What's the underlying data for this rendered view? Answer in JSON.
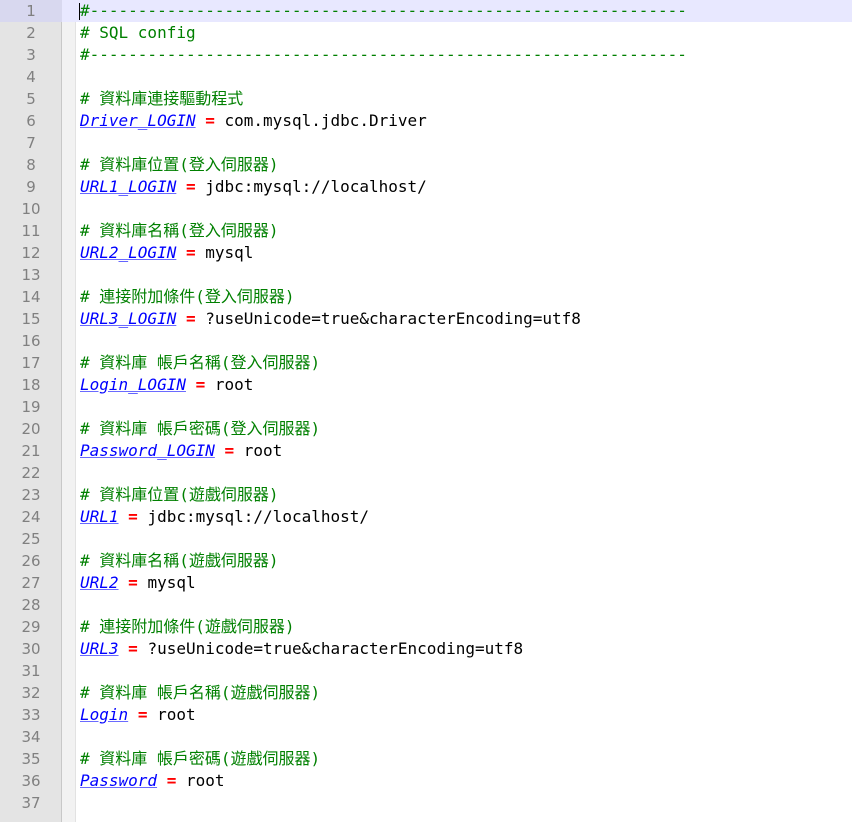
{
  "editor": {
    "colors": {
      "comment": "#008000",
      "key": "#0000ff",
      "operator": "#ff0000",
      "value": "#000000",
      "gutter_bg": "#e4e4e4",
      "line_number": "#808080",
      "current_line": "#e8e8ff"
    },
    "current_line": 1,
    "lines": [
      {
        "num": "1",
        "type": "comment",
        "text": "#--------------------------------------------------------------"
      },
      {
        "num": "2",
        "type": "comment",
        "text": "# SQL config"
      },
      {
        "num": "3",
        "type": "comment",
        "text": "#--------------------------------------------------------------"
      },
      {
        "num": "4",
        "type": "empty"
      },
      {
        "num": "5",
        "type": "comment",
        "text": "# 資料庫連接驅動程式"
      },
      {
        "num": "6",
        "type": "prop",
        "key": "Driver_LOGIN",
        "op": "=",
        "value": "com.mysql.jdbc.Driver"
      },
      {
        "num": "7",
        "type": "empty"
      },
      {
        "num": "8",
        "type": "comment",
        "text": "# 資料庫位置(登入伺服器)"
      },
      {
        "num": "9",
        "type": "prop",
        "key": "URL1_LOGIN",
        "op": "=",
        "value": "jdbc:mysql://localhost/"
      },
      {
        "num": "10",
        "type": "empty"
      },
      {
        "num": "11",
        "type": "comment",
        "text": "# 資料庫名稱(登入伺服器)"
      },
      {
        "num": "12",
        "type": "prop",
        "key": "URL2_LOGIN",
        "op": "=",
        "value": "mysql"
      },
      {
        "num": "13",
        "type": "empty"
      },
      {
        "num": "14",
        "type": "comment",
        "text": "# 連接附加條件(登入伺服器)"
      },
      {
        "num": "15",
        "type": "prop",
        "key": "URL3_LOGIN",
        "op": "=",
        "value": "?useUnicode=true&characterEncoding=utf8"
      },
      {
        "num": "16",
        "type": "empty"
      },
      {
        "num": "17",
        "type": "comment",
        "text": "# 資料庫 帳戶名稱(登入伺服器)"
      },
      {
        "num": "18",
        "type": "prop",
        "key": "Login_LOGIN",
        "op": "=",
        "value": "root"
      },
      {
        "num": "19",
        "type": "empty"
      },
      {
        "num": "20",
        "type": "comment",
        "text": "# 資料庫 帳戶密碼(登入伺服器)"
      },
      {
        "num": "21",
        "type": "prop",
        "key": "Password_LOGIN",
        "op": "=",
        "value": "root"
      },
      {
        "num": "22",
        "type": "empty"
      },
      {
        "num": "23",
        "type": "comment",
        "text": "# 資料庫位置(遊戲伺服器)"
      },
      {
        "num": "24",
        "type": "prop",
        "key": "URL1",
        "op": "=",
        "value": "jdbc:mysql://localhost/"
      },
      {
        "num": "25",
        "type": "empty"
      },
      {
        "num": "26",
        "type": "comment",
        "text": "# 資料庫名稱(遊戲伺服器)"
      },
      {
        "num": "27",
        "type": "prop",
        "key": "URL2",
        "op": "=",
        "value": "mysql"
      },
      {
        "num": "28",
        "type": "empty"
      },
      {
        "num": "29",
        "type": "comment",
        "text": "# 連接附加條件(遊戲伺服器)"
      },
      {
        "num": "30",
        "type": "prop",
        "key": "URL3",
        "op": "=",
        "value": "?useUnicode=true&characterEncoding=utf8"
      },
      {
        "num": "31",
        "type": "empty"
      },
      {
        "num": "32",
        "type": "comment",
        "text": "# 資料庫 帳戶名稱(遊戲伺服器)"
      },
      {
        "num": "33",
        "type": "prop",
        "key": "Login",
        "op": "=",
        "value": "root"
      },
      {
        "num": "34",
        "type": "empty"
      },
      {
        "num": "35",
        "type": "comment",
        "text": "# 資料庫 帳戶密碼(遊戲伺服器)"
      },
      {
        "num": "36",
        "type": "prop",
        "key": "Password",
        "op": "=",
        "value": "root"
      },
      {
        "num": "37",
        "type": "empty"
      }
    ]
  }
}
